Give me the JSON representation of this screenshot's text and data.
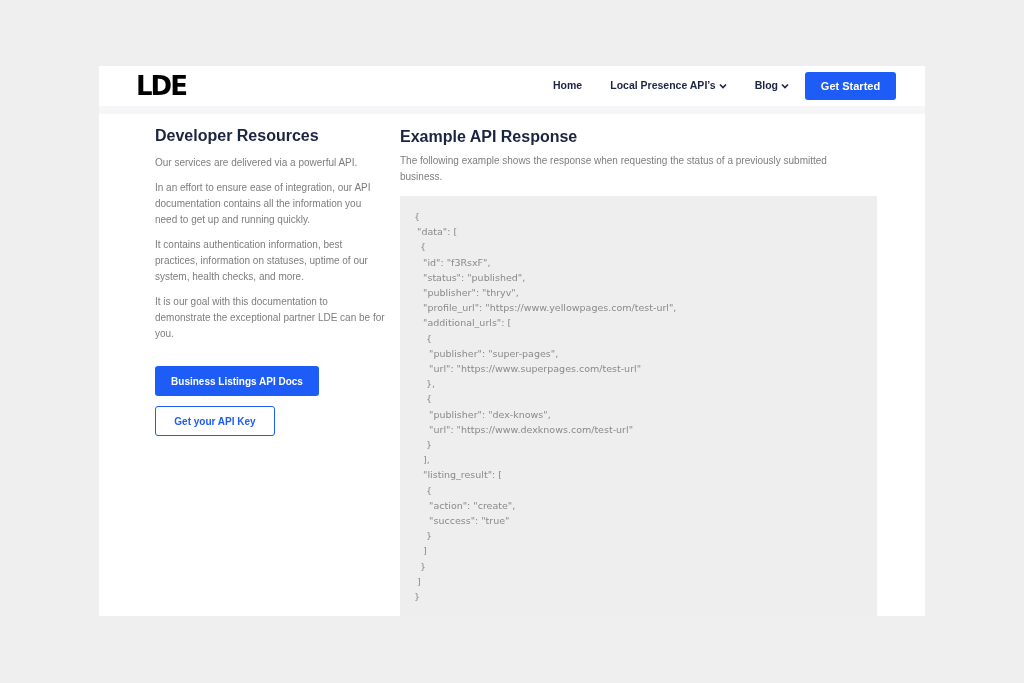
{
  "header": {
    "logo": "LDE",
    "nav": [
      {
        "label": "Home",
        "dropdown": false
      },
      {
        "label": "Local Presence API’s",
        "dropdown": true
      },
      {
        "label": "Blog",
        "dropdown": true
      }
    ],
    "cta": "Get Started"
  },
  "sidebar": {
    "title": "Developer Resources",
    "paragraphs": [
      "Our services are delivered via a powerful API.",
      "In an effort to ensure ease of integration, our API documentation contains all the information you need to get up and running quickly.",
      "It contains authentication information, best practices, information on statuses, uptime of our system, health checks, and more.",
      "It is our goal with this documentation to demonstrate the exceptional partner LDE can be for you."
    ],
    "buttons": [
      {
        "label": "Business Listings API Docs",
        "kind": "primary"
      },
      {
        "label": "Get your API Key",
        "kind": "outline"
      }
    ]
  },
  "main": {
    "title": "Example API Response",
    "description": "The following example shows the response when requesting the status of a previously submitted business.",
    "code_lines": [
      "{",
      " \"data\": [",
      "  {",
      "   \"id\": \"f3RsxF\",",
      "   \"status\": \"published\",",
      "   \"publisher\": \"thryv\",",
      "   \"profile_url\": \"https://www.yellowpages.com/test-url\",",
      "   \"additional_urls\": [",
      "    {",
      "     \"publisher\": \"super-pages\",",
      "     \"url\": \"https://www.superpages.com/test-url\"",
      "    },",
      "    {",
      "     \"publisher\": \"dex-knows\",",
      "     \"url\": \"https://www.dexknows.com/test-url\"",
      "    }",
      "   ],",
      "   \"listing_result\": [",
      "    {",
      "     \"action\": \"create\",",
      "     \"success\": \"true\"",
      "    }",
      "   ]",
      "  }",
      " ]",
      "}"
    ]
  }
}
